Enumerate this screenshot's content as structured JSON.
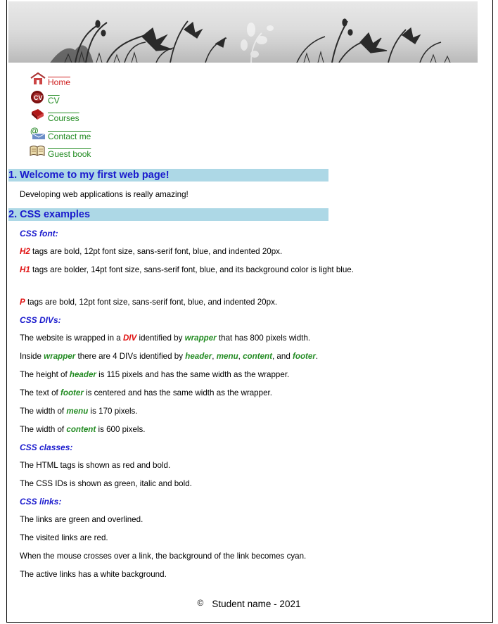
{
  "menu": {
    "items": [
      {
        "label": "Home",
        "icon": "house-icon"
      },
      {
        "label": "CV",
        "icon": "cv-badge-icon"
      },
      {
        "label": "Courses",
        "icon": "book-icon"
      },
      {
        "label": "Contact me",
        "icon": "email-icon"
      },
      {
        "label": "Guest book",
        "icon": "open-book-icon"
      }
    ]
  },
  "content": {
    "h1_welcome": "1. Welcome to my first web page!",
    "p_welcome": "Developing web applications is really amazing!",
    "h1_css": "2. CSS examples",
    "h2_font": "CSS font:",
    "p_h2_tag": "H2",
    "p_h2_text": " tags are bold, 12pt font size, sans-serif font, blue, and indented 20px.",
    "p_h1_tag": "H1",
    "p_h1_text": " tags are bolder, 14pt font size, sans-serif font, blue, and its background color is light blue.",
    "p_p_tag": "P",
    "p_p_text": " tags are bold, 12pt font size, sans-serif font, blue, and indented 20px.",
    "h2_divs": "CSS DIVs:",
    "div1_a": "The website is wrapped in a ",
    "div1_tag": "DIV",
    "div1_b": " identified by ",
    "div1_id": "wrapper",
    "div1_c": " that has 800 pixels width.",
    "div2_a": "Inside ",
    "div2_id1": "wrapper",
    "div2_b": " there are 4 DIVs identified by ",
    "div2_id2": "header",
    "div2_c": ", ",
    "div2_id3": "menu",
    "div2_d": ", ",
    "div2_id4": "content",
    "div2_e": ", and ",
    "div2_id5": "footer",
    "div2_f": ".",
    "div3_a": "The height of ",
    "div3_id": "header",
    "div3_b": " is 115 pixels and has the same width as the wrapper.",
    "div4_a": "The text of ",
    "div4_id": "footer",
    "div4_b": " is centered and has the same width as the wrapper.",
    "div5_a": "The width of ",
    "div5_id": "menu",
    "div5_b": " is 170 pixels.",
    "div6_a": "The width of ",
    "div6_id": "content",
    "div6_b": " is 600 pixels.",
    "h2_classes": "CSS classes:",
    "cls1": "The HTML tags is shown as red and bold.",
    "cls2": "The CSS IDs is shown as green, italic and bold.",
    "h2_links": "CSS links:",
    "lnk1": "The links are green and overlined.",
    "lnk2": "The visited links are red.",
    "lnk3": "When the mouse crosses over a link, the background of the link becomes cyan.",
    "lnk4": "The active links has a white background."
  },
  "footer": {
    "copyright_symbol": "©",
    "text": "Student name - 2021"
  },
  "colors": {
    "heading_blue": "#1a1acd",
    "h1_background": "#add8e6",
    "tag_red": "#e01010",
    "id_green": "#228b22",
    "link_green": "#228b22",
    "visited_red": "#d02020"
  }
}
